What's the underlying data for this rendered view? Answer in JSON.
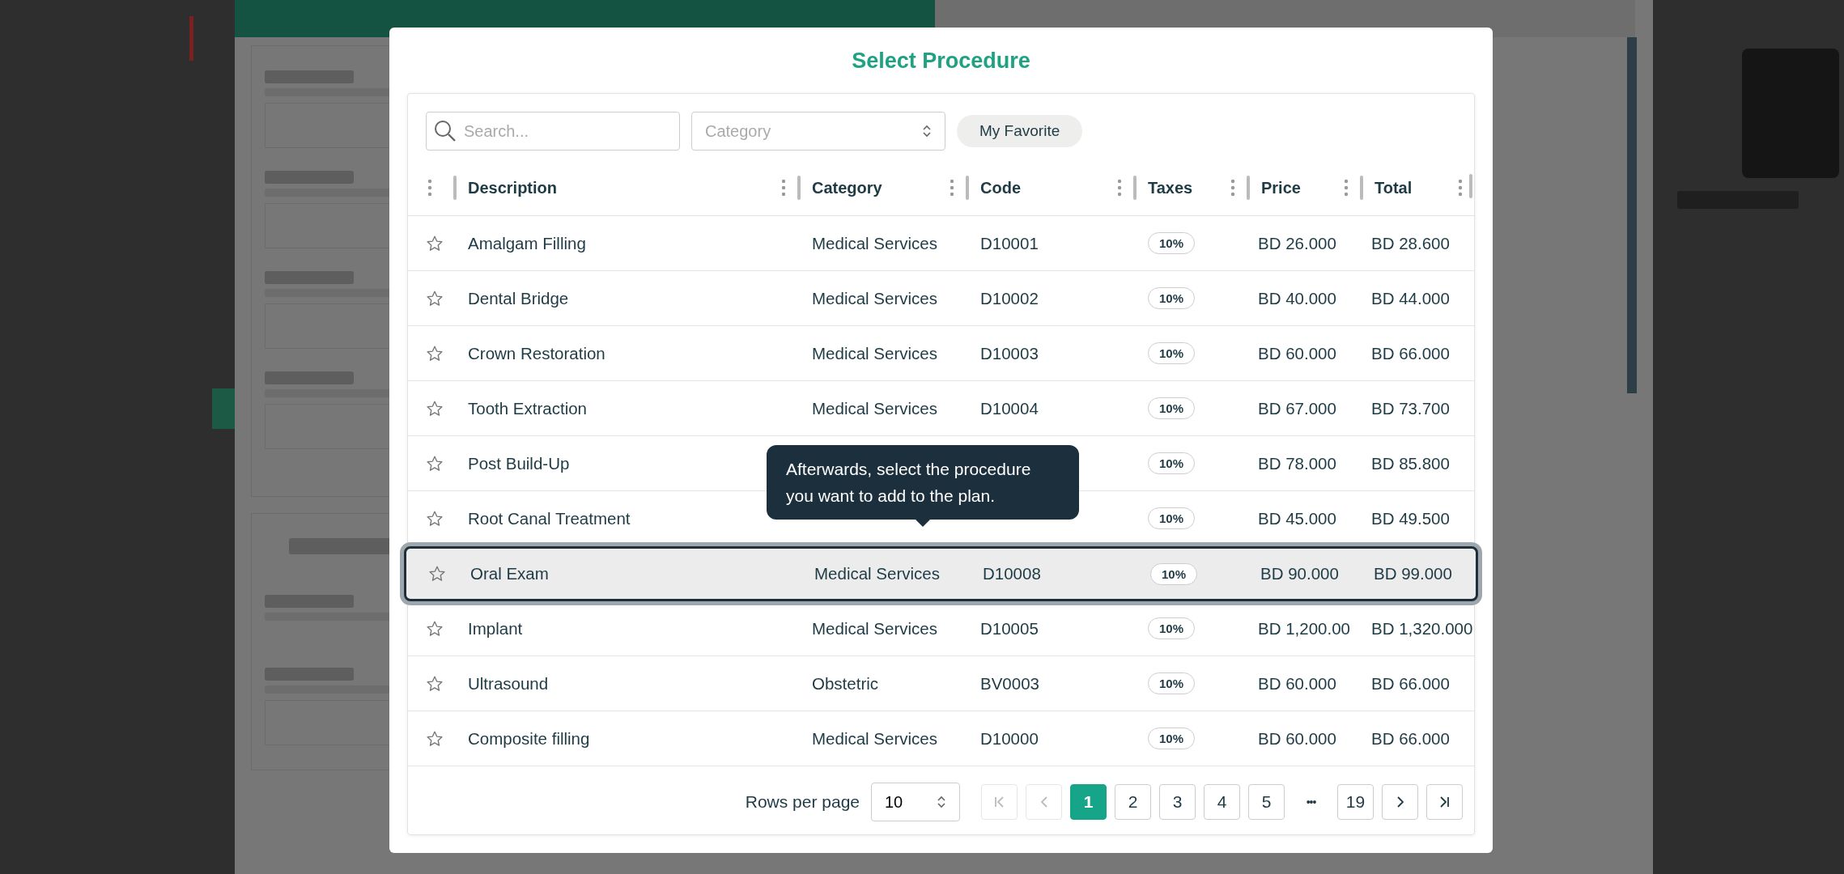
{
  "dialog": {
    "title": "Select Procedure",
    "search": {
      "placeholder": "Search..."
    },
    "category": {
      "placeholder": "Category"
    },
    "favorite_button": "My Favorite",
    "columns": [
      "Description",
      "Category",
      "Code",
      "Taxes",
      "Price",
      "Total"
    ],
    "rows": [
      {
        "description": "Amalgam Filling",
        "category": "Medical Services",
        "code": "D10001",
        "tax": "10%",
        "price": "BD 26.000",
        "total": "BD 28.600",
        "favorite": false,
        "selected": false
      },
      {
        "description": "Dental Bridge",
        "category": "Medical Services",
        "code": "D10002",
        "tax": "10%",
        "price": "BD 40.000",
        "total": "BD 44.000",
        "favorite": false,
        "selected": false
      },
      {
        "description": "Crown Restoration",
        "category": "Medical Services",
        "code": "D10003",
        "tax": "10%",
        "price": "BD 60.000",
        "total": "BD 66.000",
        "favorite": false,
        "selected": false
      },
      {
        "description": "Tooth Extraction",
        "category": "Medical Services",
        "code": "D10004",
        "tax": "10%",
        "price": "BD 67.000",
        "total": "BD 73.700",
        "favorite": false,
        "selected": false
      },
      {
        "description": "Post Build-Up",
        "tax": "10%",
        "price": "BD 78.000",
        "total": "BD 85.800",
        "favorite": false,
        "selected": false
      },
      {
        "description": "Root Canal Treatment",
        "tax": "10%",
        "price": "BD 45.000",
        "total": "BD 49.500",
        "favorite": false,
        "selected": false
      },
      {
        "description": "Oral Exam",
        "category": "Medical Services",
        "code": "D10008",
        "tax": "10%",
        "price": "BD 90.000",
        "total": "BD 99.000",
        "favorite": false,
        "selected": true
      },
      {
        "description": "Implant",
        "category": "Medical Services",
        "code": "D10005",
        "tax": "10%",
        "price": "BD 1,200.00",
        "total": "BD 1,320.000",
        "favorite": false,
        "selected": false
      },
      {
        "description": "Ultrasound",
        "category": "Obstetric",
        "code": "BV0003",
        "tax": "10%",
        "price": "BD 60.000",
        "total": "BD 66.000",
        "favorite": false,
        "selected": false
      },
      {
        "description": "Composite filling",
        "category": "Medical Services",
        "code": "D10000",
        "tax": "10%",
        "price": "BD 60.000",
        "total": "BD 66.000",
        "favorite": false,
        "selected": false
      }
    ],
    "tooltip": "Afterwards, select the procedure you want to add to the plan.",
    "pagination": {
      "rows_per_page_label": "Rows per page",
      "rows_per_page": "10",
      "pages": [
        {
          "kind": "page",
          "label": "1",
          "selected": true
        },
        {
          "kind": "page",
          "label": "2",
          "selected": false
        },
        {
          "kind": "page",
          "label": "3",
          "selected": false
        },
        {
          "kind": "page",
          "label": "4",
          "selected": false
        },
        {
          "kind": "page",
          "label": "5",
          "selected": false
        },
        {
          "kind": "ellipsis",
          "label": "•••"
        },
        {
          "kind": "page",
          "label": "19",
          "selected": false
        }
      ]
    }
  }
}
